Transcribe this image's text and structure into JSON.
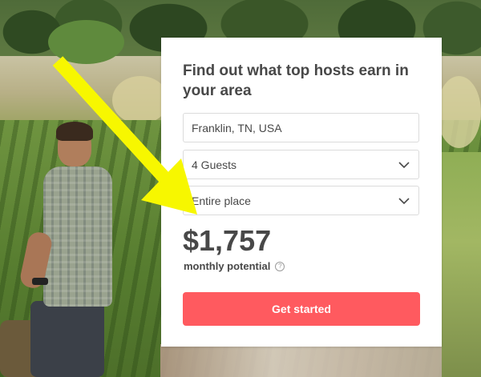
{
  "card": {
    "title": "Find out what top hosts earn in your area",
    "location_value": "Franklin, TN, USA",
    "guests_value": "4 Guests",
    "place_value": "Entire place",
    "amount": "$1,757",
    "amount_caption": "monthly potential",
    "help_glyph": "?",
    "cta_label": "Get started"
  },
  "icons": {
    "chevron": "chevron-down-icon",
    "help": "question-circle-icon"
  },
  "colors": {
    "accent": "#ff5a5f",
    "text": "#484848",
    "border": "#dbdbdb",
    "annotation_arrow": "#f7f700"
  }
}
